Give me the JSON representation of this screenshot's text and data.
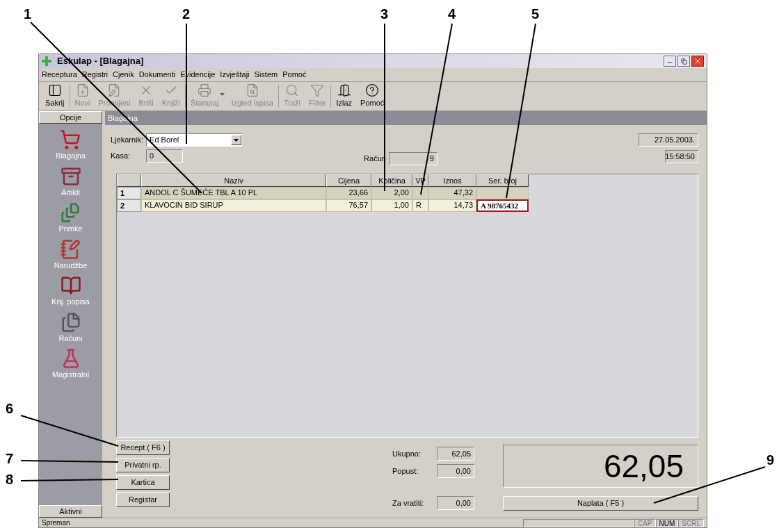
{
  "callouts": [
    "1",
    "2",
    "3",
    "4",
    "5",
    "6",
    "7",
    "8",
    "9"
  ],
  "window": {
    "title": "Eskulap - [Blagajna]"
  },
  "menu": [
    "Receptura",
    "Registri",
    "Cjenik",
    "Dokumenti",
    "Evidencije",
    "Izvještaji",
    "Sistem",
    "Pomoć"
  ],
  "toolbar": [
    {
      "label": "Sakrij",
      "disabled": false
    },
    {
      "label": "Novi",
      "disabled": true
    },
    {
      "label": "Promijeni",
      "disabled": true
    },
    {
      "label": "Briši",
      "disabled": true
    },
    {
      "label": "Knjiži",
      "disabled": true
    },
    {
      "label": "Štampaj",
      "disabled": true,
      "dropdown": true
    },
    {
      "label": "Izgled ispisa",
      "disabled": true
    },
    {
      "label": "Traži",
      "disabled": true
    },
    {
      "label": "Filter",
      "disabled": true
    },
    {
      "label": "Izlaz",
      "disabled": false
    },
    {
      "label": "Pomoć",
      "disabled": false
    }
  ],
  "sidebar": {
    "header": "Opcije",
    "items": [
      "Blagajna",
      "Artikli",
      "Primke",
      "Narudžbe",
      "Knj. popisa",
      "Računi",
      "Magistralni"
    ],
    "footer": "Aktivni"
  },
  "panel": {
    "title": "Blagajna",
    "ljekarnik": {
      "label": "Ljekarnik:",
      "value": "Ed Borel"
    },
    "kasa": {
      "label": "Kasa:",
      "value": "0"
    },
    "racun": {
      "label": "Račun",
      "value": "9"
    },
    "date": "27.05.2003.",
    "time": "15:58:50",
    "table": {
      "columns": [
        "Naziv",
        "Cijena",
        "Količina",
        "VP",
        "Iznos",
        "Ser. broj"
      ],
      "rows": [
        {
          "number": "1",
          "selected": true,
          "editing": false,
          "naziv": "ANDOL C ŠUMEĆE TBL A 10 PL",
          "cijena": "23,66",
          "kolicina": "2,00",
          "iznos": "47,32"
        },
        {
          "number": "2",
          "selected": false,
          "editing": true,
          "naziv": "KLAVOCIN BID SIRUP",
          "cijena": "76,57",
          "kolicina": "1,00",
          "vp": "R",
          "iznos": "14,73",
          "ser_broj": "A 98765432"
        }
      ]
    },
    "buttons": [
      "Recept ( F6 )",
      "Privatni rp.",
      "Kartica",
      "Registar"
    ],
    "totals": [
      {
        "label": "Ukupno:",
        "value": "62,05"
      },
      {
        "label": "Popust:",
        "value": "0,00"
      },
      {
        "label": "Za vratiti:",
        "value": "0,00"
      }
    ],
    "display": "62,05",
    "pay_button": "Naplata ( F5 )"
  },
  "status_bar": {
    "text": "Spreman",
    "indicators": [
      {
        "label": "CAP",
        "on": false
      },
      {
        "label": "NUM",
        "on": true
      },
      {
        "label": "SCRL",
        "on": false
      }
    ]
  }
}
